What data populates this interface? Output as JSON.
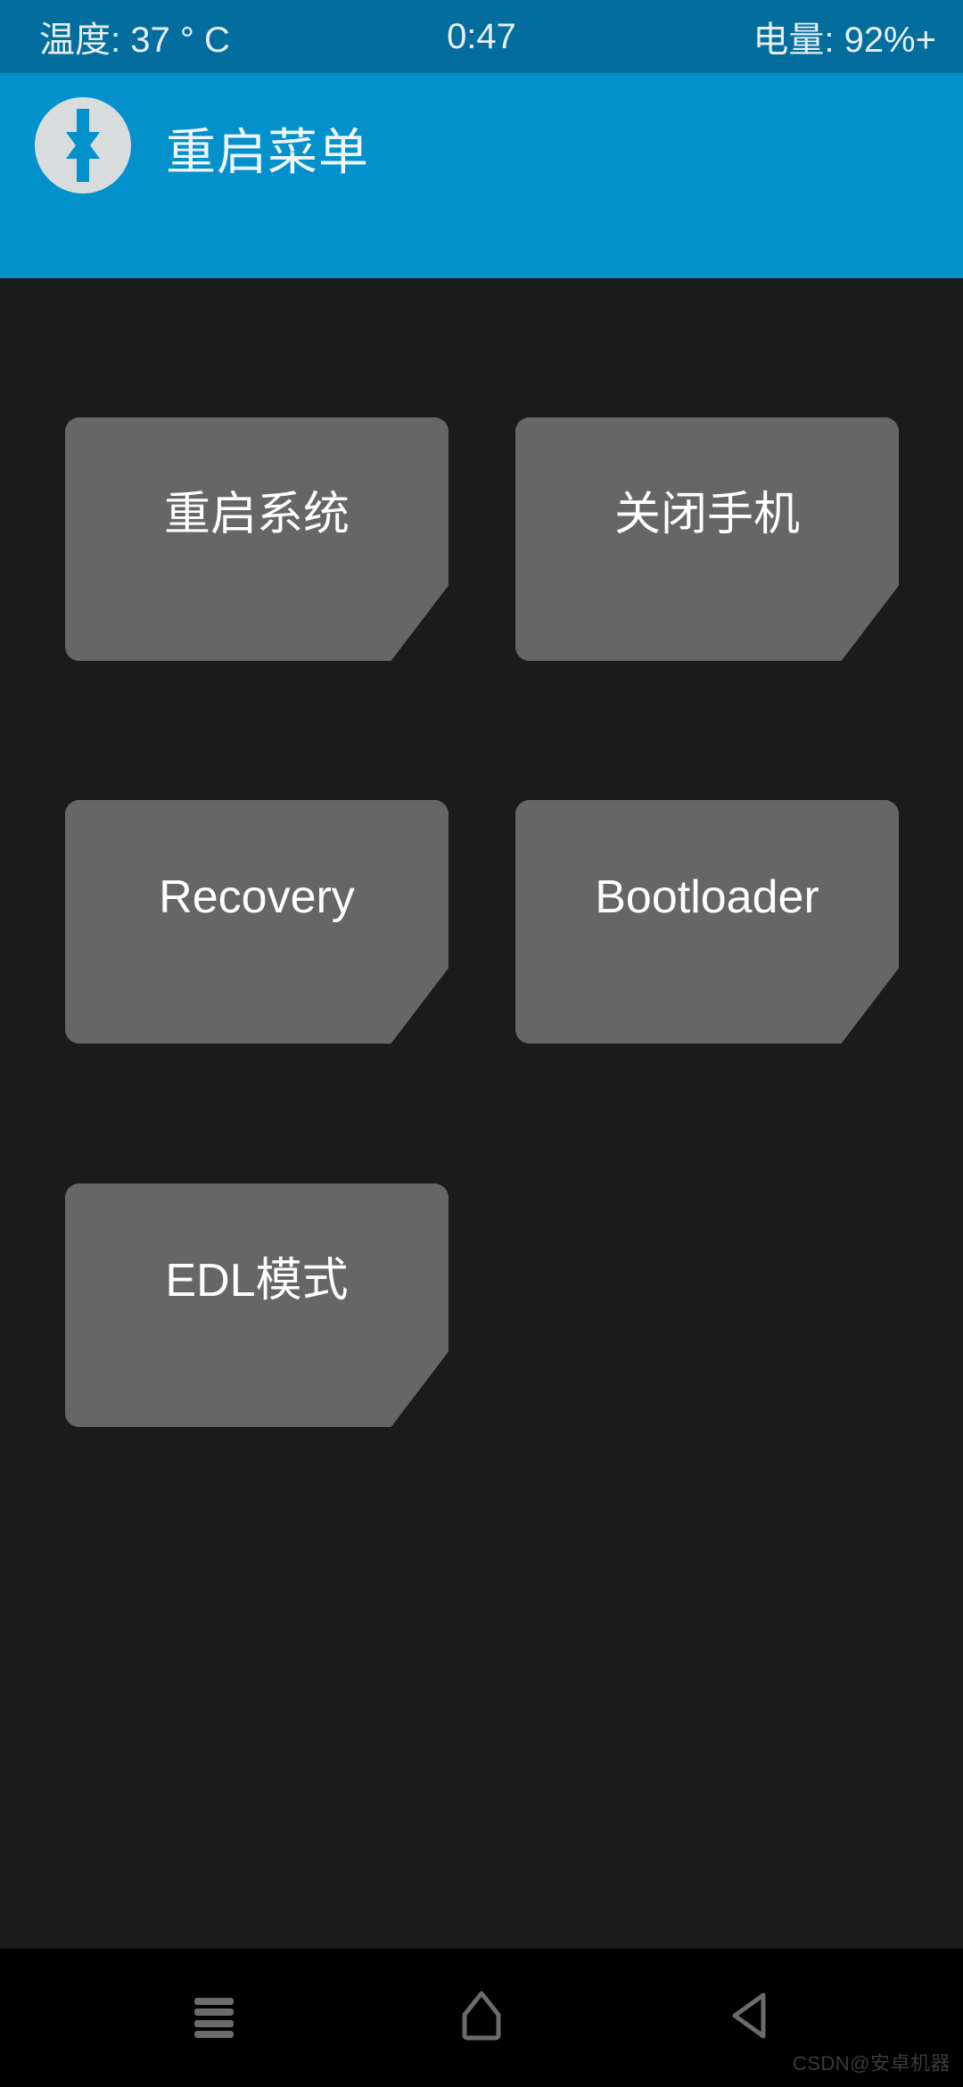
{
  "status_bar": {
    "temperature_label": "温度:",
    "temperature_value": "37",
    "temperature_unit_degree": "°",
    "temperature_unit_c": "C",
    "temperature_full": "温度: 37 ° C",
    "clock": "0:47",
    "battery": "电量: 92%+",
    "background_color": "#036e9e",
    "text_color": "#e8eef1"
  },
  "app_bar": {
    "title": "重启菜单",
    "logo_icon": "twrp-logo-icon",
    "background_color": "#0391cb",
    "logo_color": "#d8dcdd",
    "title_color": "#f2f6f8"
  },
  "content": {
    "background_color": "#1b1b1b",
    "tile_color": "#666666",
    "tile_text_color": "#ffffff",
    "tiles": [
      {
        "label": "重启系统",
        "name": "reboot-system-tile"
      },
      {
        "label": "关闭手机",
        "name": "power-off-tile"
      },
      {
        "label": "Recovery",
        "name": "recovery-tile"
      },
      {
        "label": "Bootloader",
        "name": "bootloader-tile"
      },
      {
        "label": "EDL模式",
        "name": "edl-mode-tile"
      }
    ]
  },
  "nav_bar": {
    "background_color": "#000000",
    "icon_color": "#6b6b6b",
    "recents_icon": "menu-hamburger-icon",
    "home_icon": "home-icon",
    "back_icon": "back-triangle-icon"
  },
  "watermark": {
    "text": "CSDN@安卓机器"
  }
}
